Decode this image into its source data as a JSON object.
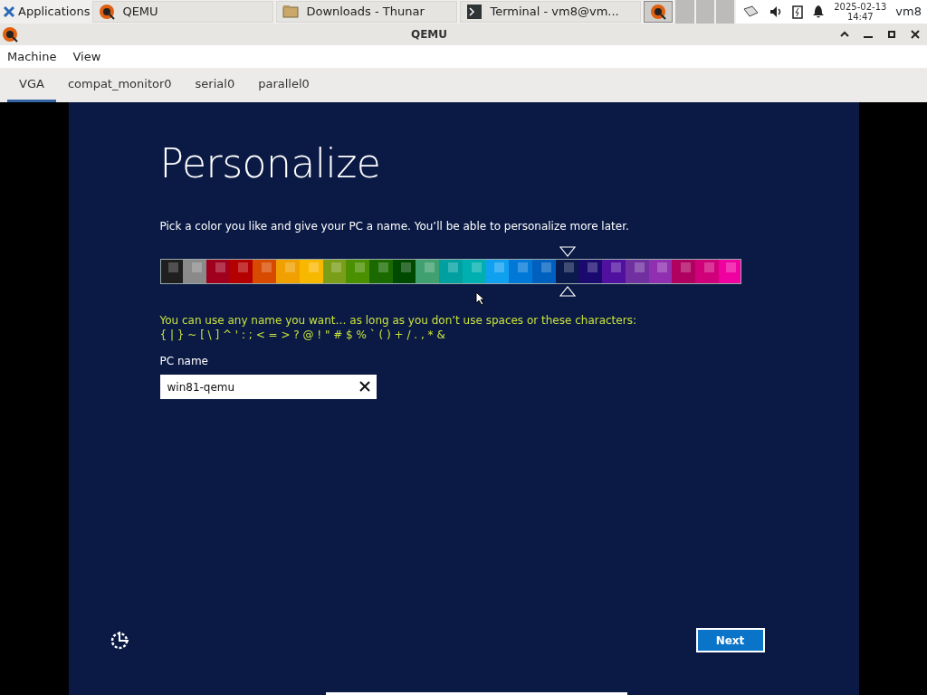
{
  "taskbar": {
    "menu_label": "Applications",
    "tasks": [
      {
        "label": "QEMU",
        "kind": "qemu",
        "selected": false
      },
      {
        "label": "Downloads - Thunar",
        "kind": "folder",
        "selected": false
      },
      {
        "label": "Terminal - vm8@vm...",
        "kind": "terminal",
        "selected": false
      },
      {
        "kind": "qemu",
        "selected": true
      }
    ],
    "date": "2025-02-13",
    "time": "14:47",
    "user": "vm8"
  },
  "window": {
    "title": "QEMU"
  },
  "menu": [
    "Machine",
    "View"
  ],
  "tabs": [
    {
      "label": "VGA",
      "selected": true
    },
    {
      "label": "compat_monitor0",
      "selected": false
    },
    {
      "label": "serial0",
      "selected": false
    },
    {
      "label": "parallel0",
      "selected": false
    }
  ],
  "setup": {
    "heading": "Personalize",
    "intro": "Pick a color you like and give your PC a name. You’ll be able to personalize more later.",
    "swatches": [
      {
        "color": "#1f1f1f",
        "selected": false
      },
      {
        "color": "#8a8a8a",
        "selected": false
      },
      {
        "color": "#a0001e",
        "selected": false
      },
      {
        "color": "#b50000",
        "selected": false
      },
      {
        "color": "#d84a00",
        "selected": false
      },
      {
        "color": "#f0a000",
        "selected": false
      },
      {
        "color": "#f8b800",
        "selected": false
      },
      {
        "color": "#7a9e18",
        "selected": false
      },
      {
        "color": "#4a9000",
        "selected": false
      },
      {
        "color": "#1a6a00",
        "selected": false
      },
      {
        "color": "#004a00",
        "selected": false
      },
      {
        "color": "#40a070",
        "selected": false
      },
      {
        "color": "#00a0a0",
        "selected": false
      },
      {
        "color": "#00b0b0",
        "selected": false
      },
      {
        "color": "#10a0f0",
        "selected": false
      },
      {
        "color": "#0078d8",
        "selected": false
      },
      {
        "color": "#0060c0",
        "selected": false
      },
      {
        "color": "#0a1a4a",
        "selected": true
      },
      {
        "color": "#1a0a70",
        "selected": false
      },
      {
        "color": "#5010a0",
        "selected": false
      },
      {
        "color": "#7030a0",
        "selected": false
      },
      {
        "color": "#9030b0",
        "selected": false
      },
      {
        "color": "#b00060",
        "selected": false
      },
      {
        "color": "#d0007a",
        "selected": false
      },
      {
        "color": "#f000a0",
        "selected": false
      }
    ],
    "warning": [
      "You can use any name you want… as long as you don’t use spaces or these characters:",
      "{ | } ~ [ \\ ] ^ ' : ; < = > ? @ ! \" # $ % ` ( ) + / . , * &"
    ],
    "field_label": "PC name",
    "field_value": "win81-qemu",
    "next": "Next"
  }
}
